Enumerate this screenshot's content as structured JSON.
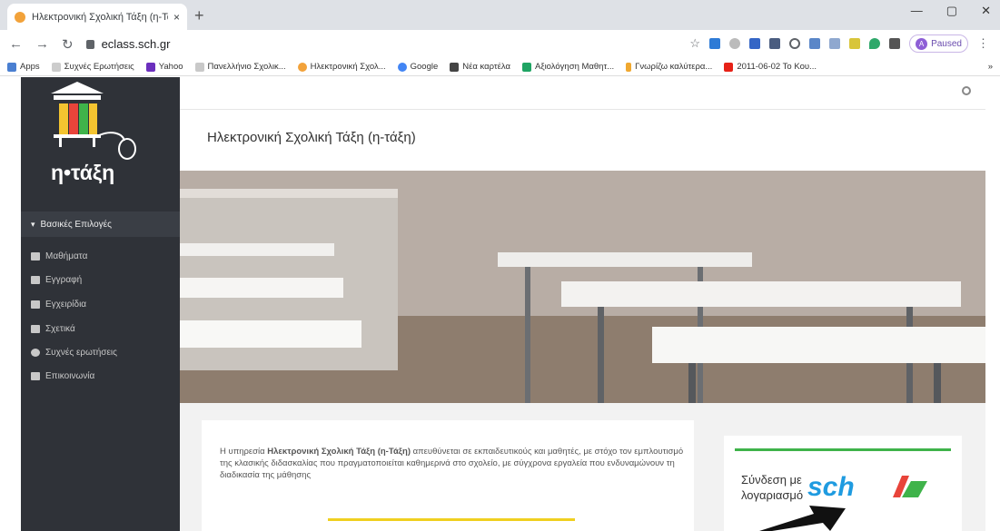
{
  "browser": {
    "tab_title": "Ηλεκτρονική Σχολική Τάξη (η-Τά",
    "tab_close": "×",
    "new_tab": "+",
    "url": "eclass.sch.gr",
    "profile_initial": "A",
    "profile_status": "Paused",
    "bookmarks": [
      "Apps",
      "Συχνές Ερωτήσεις",
      "Yahoo",
      "Πανελλήνιο Σχολικ...",
      "Ηλεκτρονική Σχολ...",
      "Google",
      "Νέα καρτέλα",
      "Αξιολόγηση Μαθητ...",
      "Γνωρίζω καλύτερα...",
      "2011-06-02 Το Κου..."
    ],
    "bookmarks_more": "»"
  },
  "sidebar": {
    "logo_text": "η•τάξη",
    "menu_header": "Βασικές Επιλογές",
    "items": [
      {
        "label": "Μαθήματα",
        "icon": "graduation-cap-icon"
      },
      {
        "label": "Εγγραφή",
        "icon": "edit-icon"
      },
      {
        "label": "Εγχειρίδια",
        "icon": "document-icon"
      },
      {
        "label": "Σχετικά",
        "icon": "card-icon"
      },
      {
        "label": "Συχνές ερωτήσεις",
        "icon": "question-icon"
      },
      {
        "label": "Επικοινωνία",
        "icon": "phone-icon"
      }
    ]
  },
  "main": {
    "page_title": "Ηλεκτρονική Σχολική Τάξη (η-τάξη)",
    "intro_prefix": "Η υπηρεσία ",
    "intro_bold": "Ηλεκτρονική Σχολική Τάξη (η-Τάξη)",
    "intro_rest": " απευθύνεται σε εκπαιδευτικούς και μαθητές, με στόχο τον εμπλουτισμό της κλασικής διδασκαλίας που πραγματοποιείται καθημερινά στο σχολείο, με σύγχρονα εργαλεία που ενδυναμώνουν τη διαδικασία της μάθησης",
    "login_label": "Σύνδεση με λογαριασμό",
    "login_brand": "sch"
  },
  "colors": {
    "sidebar_bg": "#2f3238",
    "accent_green": "#3fb34a",
    "accent_yellow": "#f0d020",
    "sch_blue": "#1f9be0"
  }
}
